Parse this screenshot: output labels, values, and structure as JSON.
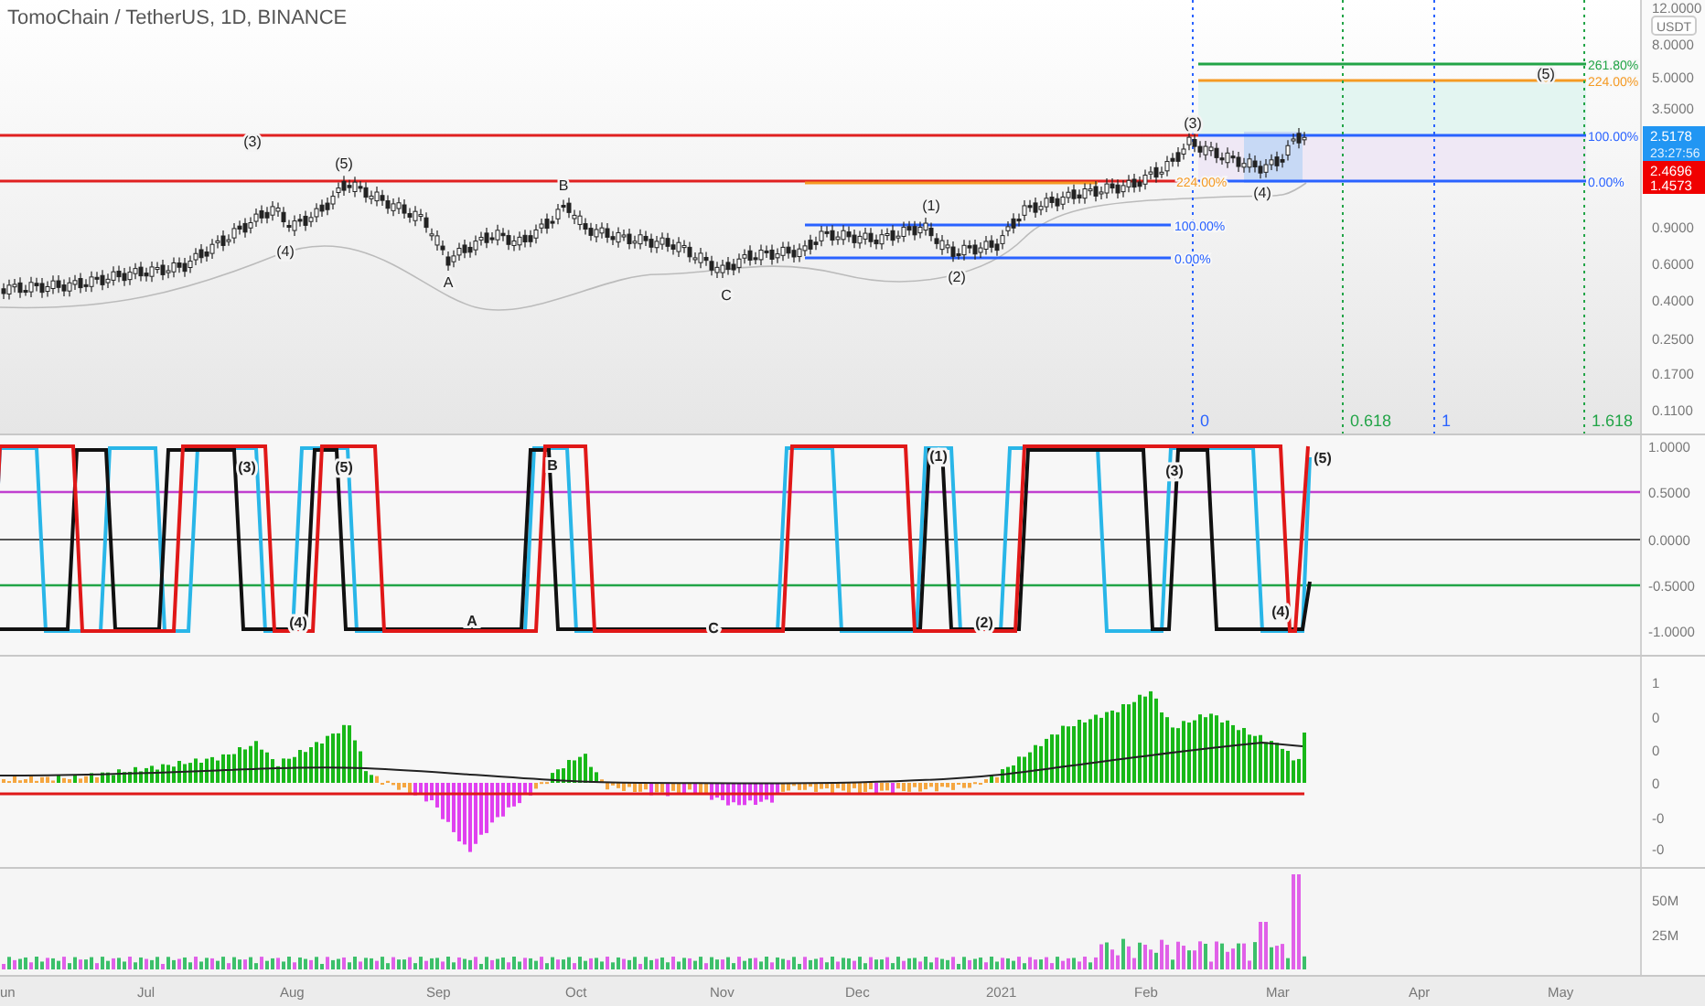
{
  "header": {
    "title": "TomoChain / TetherUS, 1D, BINANCE"
  },
  "price_pane": {
    "currency": "USDT",
    "axis_labels": [
      "12.0000",
      "8.0000",
      "5.0000",
      "3.5000",
      "0.9000",
      "0.6000",
      "0.4000",
      "0.2500",
      "0.1700",
      "0.1100"
    ],
    "last_price": {
      "value": "2.5178",
      "countdown": "23:27:56"
    },
    "level_tags": [
      "2.4696",
      "1.4573"
    ],
    "wave_labels": [
      "(3)",
      "(5)",
      "(4)",
      "A",
      "B",
      "C",
      "(1)",
      "(2)",
      "(3)",
      "(4)",
      "(5)"
    ],
    "fib_labels": [
      {
        "text": "261.80%",
        "color": "#22a447"
      },
      {
        "text": "224.00%",
        "color": "#f59a23"
      },
      {
        "text": "100.00%",
        "color": "#2962ff"
      },
      {
        "text": "224.00%",
        "color": "#f59a23"
      },
      {
        "text": "0.00%",
        "color": "#2962ff"
      },
      {
        "text": "100.00%",
        "color": "#2962ff"
      },
      {
        "text": "0.00%",
        "color": "#2962ff"
      }
    ],
    "time_fib_labels": [
      {
        "text": "0",
        "color": "#2962ff"
      },
      {
        "text": "0.618",
        "color": "#22a447"
      },
      {
        "text": "1",
        "color": "#2962ff"
      },
      {
        "text": "1.618",
        "color": "#22a447"
      }
    ]
  },
  "oscillator_pane": {
    "axis_labels": [
      "1.0000",
      "0.5000",
      "0.0000",
      "-0.5000",
      "-1.0000"
    ],
    "wave_labels": [
      "(3)",
      "(5)",
      "B",
      "(4)",
      "A",
      "C",
      "(1)",
      "(2)",
      "(3)",
      "(4)",
      "(5)"
    ]
  },
  "histogram_pane": {
    "axis_labels": [
      "1",
      "0",
      "0",
      "0",
      "-0",
      "-0"
    ]
  },
  "volume_pane": {
    "axis_labels": [
      "50M",
      "25M"
    ]
  },
  "time_axis": {
    "labels": [
      "un",
      "Jul",
      "Aug",
      "Sep",
      "Oct",
      "Nov",
      "Dec",
      "2021",
      "Feb",
      "Mar",
      "Apr",
      "May"
    ]
  }
}
